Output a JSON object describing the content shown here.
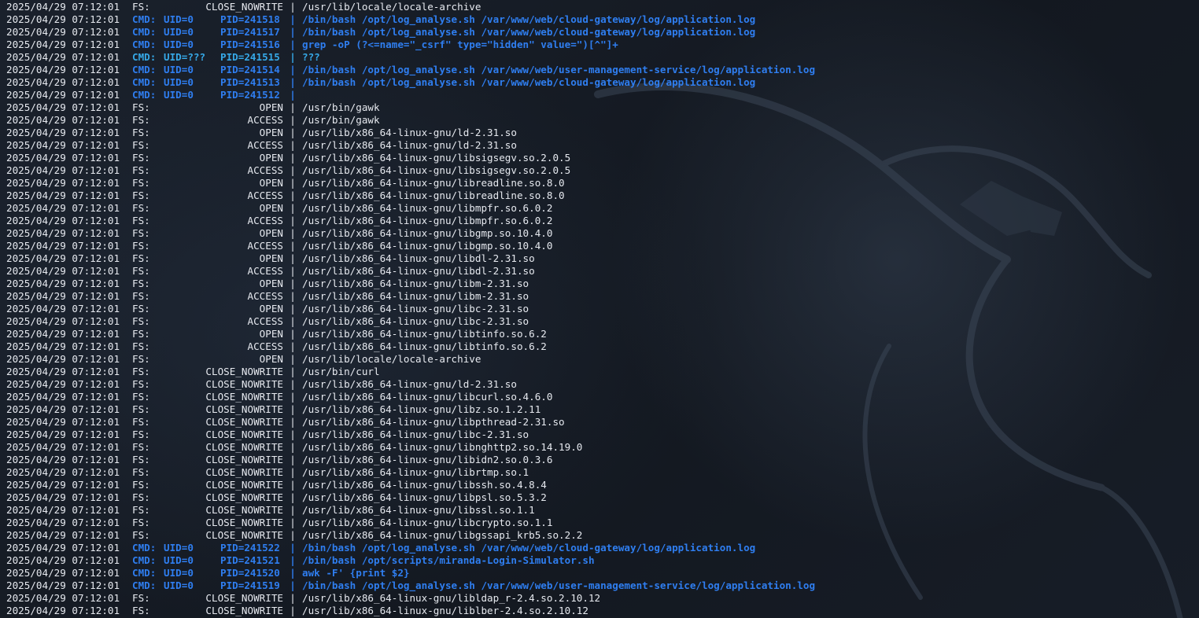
{
  "terminal": {
    "colors": {
      "background": "#151a22",
      "text": "#e6e9ef",
      "cmd_highlight": "#2f7ef0",
      "unknown_uid_highlight": "#36a9e8"
    },
    "lines": [
      {
        "ts": "2025/04/29 07:12:01",
        "type": "fs",
        "src": "FS:",
        "event": "CLOSE_NOWRITE",
        "sep": "|",
        "path": "/usr/lib/locale/locale-archive"
      },
      {
        "ts": "2025/04/29 07:12:01",
        "type": "cmd",
        "src": "CMD:",
        "uid": "UID=0",
        "pid": "PID=241518",
        "sep": "|",
        "path": "/bin/bash /opt/log_analyse.sh /var/www/web/cloud-gateway/log/application.log"
      },
      {
        "ts": "2025/04/29 07:12:01",
        "type": "cmd",
        "src": "CMD:",
        "uid": "UID=0",
        "pid": "PID=241517",
        "sep": "|",
        "path": "/bin/bash /opt/log_analyse.sh /var/www/web/cloud-gateway/log/application.log"
      },
      {
        "ts": "2025/04/29 07:12:01",
        "type": "cmd",
        "src": "CMD:",
        "uid": "UID=0",
        "pid": "PID=241516",
        "sep": "|",
        "path": "grep -oP (?<=name=\"_csrf\" type=\"hidden\" value=\")[^\"]+"
      },
      {
        "ts": "2025/04/29 07:12:01",
        "type": "cmd-unknown",
        "src": "CMD:",
        "uid": "UID=???",
        "pid": "PID=241515",
        "sep": "|",
        "path": "???"
      },
      {
        "ts": "2025/04/29 07:12:01",
        "type": "cmd",
        "src": "CMD:",
        "uid": "UID=0",
        "pid": "PID=241514",
        "sep": "|",
        "path": "/bin/bash /opt/log_analyse.sh /var/www/web/user-management-service/log/application.log"
      },
      {
        "ts": "2025/04/29 07:12:01",
        "type": "cmd",
        "src": "CMD:",
        "uid": "UID=0",
        "pid": "PID=241513",
        "sep": "|",
        "path": "/bin/bash /opt/log_analyse.sh /var/www/web/cloud-gateway/log/application.log"
      },
      {
        "ts": "2025/04/29 07:12:01",
        "type": "cmd",
        "src": "CMD:",
        "uid": "UID=0",
        "pid": "PID=241512",
        "sep": "|",
        "path": ""
      },
      {
        "ts": "2025/04/29 07:12:01",
        "type": "fs",
        "src": "FS:",
        "event": "OPEN",
        "sep": "|",
        "path": "/usr/bin/gawk"
      },
      {
        "ts": "2025/04/29 07:12:01",
        "type": "fs",
        "src": "FS:",
        "event": "ACCESS",
        "sep": "|",
        "path": "/usr/bin/gawk"
      },
      {
        "ts": "2025/04/29 07:12:01",
        "type": "fs",
        "src": "FS:",
        "event": "OPEN",
        "sep": "|",
        "path": "/usr/lib/x86_64-linux-gnu/ld-2.31.so"
      },
      {
        "ts": "2025/04/29 07:12:01",
        "type": "fs",
        "src": "FS:",
        "event": "ACCESS",
        "sep": "|",
        "path": "/usr/lib/x86_64-linux-gnu/ld-2.31.so"
      },
      {
        "ts": "2025/04/29 07:12:01",
        "type": "fs",
        "src": "FS:",
        "event": "OPEN",
        "sep": "|",
        "path": "/usr/lib/x86_64-linux-gnu/libsigsegv.so.2.0.5"
      },
      {
        "ts": "2025/04/29 07:12:01",
        "type": "fs",
        "src": "FS:",
        "event": "ACCESS",
        "sep": "|",
        "path": "/usr/lib/x86_64-linux-gnu/libsigsegv.so.2.0.5"
      },
      {
        "ts": "2025/04/29 07:12:01",
        "type": "fs",
        "src": "FS:",
        "event": "OPEN",
        "sep": "|",
        "path": "/usr/lib/x86_64-linux-gnu/libreadline.so.8.0"
      },
      {
        "ts": "2025/04/29 07:12:01",
        "type": "fs",
        "src": "FS:",
        "event": "ACCESS",
        "sep": "|",
        "path": "/usr/lib/x86_64-linux-gnu/libreadline.so.8.0"
      },
      {
        "ts": "2025/04/29 07:12:01",
        "type": "fs",
        "src": "FS:",
        "event": "OPEN",
        "sep": "|",
        "path": "/usr/lib/x86_64-linux-gnu/libmpfr.so.6.0.2"
      },
      {
        "ts": "2025/04/29 07:12:01",
        "type": "fs",
        "src": "FS:",
        "event": "ACCESS",
        "sep": "|",
        "path": "/usr/lib/x86_64-linux-gnu/libmpfr.so.6.0.2"
      },
      {
        "ts": "2025/04/29 07:12:01",
        "type": "fs",
        "src": "FS:",
        "event": "OPEN",
        "sep": "|",
        "path": "/usr/lib/x86_64-linux-gnu/libgmp.so.10.4.0"
      },
      {
        "ts": "2025/04/29 07:12:01",
        "type": "fs",
        "src": "FS:",
        "event": "ACCESS",
        "sep": "|",
        "path": "/usr/lib/x86_64-linux-gnu/libgmp.so.10.4.0"
      },
      {
        "ts": "2025/04/29 07:12:01",
        "type": "fs",
        "src": "FS:",
        "event": "OPEN",
        "sep": "|",
        "path": "/usr/lib/x86_64-linux-gnu/libdl-2.31.so"
      },
      {
        "ts": "2025/04/29 07:12:01",
        "type": "fs",
        "src": "FS:",
        "event": "ACCESS",
        "sep": "|",
        "path": "/usr/lib/x86_64-linux-gnu/libdl-2.31.so"
      },
      {
        "ts": "2025/04/29 07:12:01",
        "type": "fs",
        "src": "FS:",
        "event": "OPEN",
        "sep": "|",
        "path": "/usr/lib/x86_64-linux-gnu/libm-2.31.so"
      },
      {
        "ts": "2025/04/29 07:12:01",
        "type": "fs",
        "src": "FS:",
        "event": "ACCESS",
        "sep": "|",
        "path": "/usr/lib/x86_64-linux-gnu/libm-2.31.so"
      },
      {
        "ts": "2025/04/29 07:12:01",
        "type": "fs",
        "src": "FS:",
        "event": "OPEN",
        "sep": "|",
        "path": "/usr/lib/x86_64-linux-gnu/libc-2.31.so"
      },
      {
        "ts": "2025/04/29 07:12:01",
        "type": "fs",
        "src": "FS:",
        "event": "ACCESS",
        "sep": "|",
        "path": "/usr/lib/x86_64-linux-gnu/libc-2.31.so"
      },
      {
        "ts": "2025/04/29 07:12:01",
        "type": "fs",
        "src": "FS:",
        "event": "OPEN",
        "sep": "|",
        "path": "/usr/lib/x86_64-linux-gnu/libtinfo.so.6.2"
      },
      {
        "ts": "2025/04/29 07:12:01",
        "type": "fs",
        "src": "FS:",
        "event": "ACCESS",
        "sep": "|",
        "path": "/usr/lib/x86_64-linux-gnu/libtinfo.so.6.2"
      },
      {
        "ts": "2025/04/29 07:12:01",
        "type": "fs",
        "src": "FS:",
        "event": "OPEN",
        "sep": "|",
        "path": "/usr/lib/locale/locale-archive"
      },
      {
        "ts": "2025/04/29 07:12:01",
        "type": "fs",
        "src": "FS:",
        "event": "CLOSE_NOWRITE",
        "sep": "|",
        "path": "/usr/bin/curl"
      },
      {
        "ts": "2025/04/29 07:12:01",
        "type": "fs",
        "src": "FS:",
        "event": "CLOSE_NOWRITE",
        "sep": "|",
        "path": "/usr/lib/x86_64-linux-gnu/ld-2.31.so"
      },
      {
        "ts": "2025/04/29 07:12:01",
        "type": "fs",
        "src": "FS:",
        "event": "CLOSE_NOWRITE",
        "sep": "|",
        "path": "/usr/lib/x86_64-linux-gnu/libcurl.so.4.6.0"
      },
      {
        "ts": "2025/04/29 07:12:01",
        "type": "fs",
        "src": "FS:",
        "event": "CLOSE_NOWRITE",
        "sep": "|",
        "path": "/usr/lib/x86_64-linux-gnu/libz.so.1.2.11"
      },
      {
        "ts": "2025/04/29 07:12:01",
        "type": "fs",
        "src": "FS:",
        "event": "CLOSE_NOWRITE",
        "sep": "|",
        "path": "/usr/lib/x86_64-linux-gnu/libpthread-2.31.so"
      },
      {
        "ts": "2025/04/29 07:12:01",
        "type": "fs",
        "src": "FS:",
        "event": "CLOSE_NOWRITE",
        "sep": "|",
        "path": "/usr/lib/x86_64-linux-gnu/libc-2.31.so"
      },
      {
        "ts": "2025/04/29 07:12:01",
        "type": "fs",
        "src": "FS:",
        "event": "CLOSE_NOWRITE",
        "sep": "|",
        "path": "/usr/lib/x86_64-linux-gnu/libnghttp2.so.14.19.0"
      },
      {
        "ts": "2025/04/29 07:12:01",
        "type": "fs",
        "src": "FS:",
        "event": "CLOSE_NOWRITE",
        "sep": "|",
        "path": "/usr/lib/x86_64-linux-gnu/libidn2.so.0.3.6"
      },
      {
        "ts": "2025/04/29 07:12:01",
        "type": "fs",
        "src": "FS:",
        "event": "CLOSE_NOWRITE",
        "sep": "|",
        "path": "/usr/lib/x86_64-linux-gnu/librtmp.so.1"
      },
      {
        "ts": "2025/04/29 07:12:01",
        "type": "fs",
        "src": "FS:",
        "event": "CLOSE_NOWRITE",
        "sep": "|",
        "path": "/usr/lib/x86_64-linux-gnu/libssh.so.4.8.4"
      },
      {
        "ts": "2025/04/29 07:12:01",
        "type": "fs",
        "src": "FS:",
        "event": "CLOSE_NOWRITE",
        "sep": "|",
        "path": "/usr/lib/x86_64-linux-gnu/libpsl.so.5.3.2"
      },
      {
        "ts": "2025/04/29 07:12:01",
        "type": "fs",
        "src": "FS:",
        "event": "CLOSE_NOWRITE",
        "sep": "|",
        "path": "/usr/lib/x86_64-linux-gnu/libssl.so.1.1"
      },
      {
        "ts": "2025/04/29 07:12:01",
        "type": "fs",
        "src": "FS:",
        "event": "CLOSE_NOWRITE",
        "sep": "|",
        "path": "/usr/lib/x86_64-linux-gnu/libcrypto.so.1.1"
      },
      {
        "ts": "2025/04/29 07:12:01",
        "type": "fs",
        "src": "FS:",
        "event": "CLOSE_NOWRITE",
        "sep": "|",
        "path": "/usr/lib/x86_64-linux-gnu/libgssapi_krb5.so.2.2"
      },
      {
        "ts": "2025/04/29 07:12:01",
        "type": "cmd",
        "src": "CMD:",
        "uid": "UID=0",
        "pid": "PID=241522",
        "sep": "|",
        "path": "/bin/bash /opt/log_analyse.sh /var/www/web/cloud-gateway/log/application.log"
      },
      {
        "ts": "2025/04/29 07:12:01",
        "type": "cmd",
        "src": "CMD:",
        "uid": "UID=0",
        "pid": "PID=241521",
        "sep": "|",
        "path": "/bin/bash /opt/scripts/miranda-Login-Simulator.sh"
      },
      {
        "ts": "2025/04/29 07:12:01",
        "type": "cmd",
        "src": "CMD:",
        "uid": "UID=0",
        "pid": "PID=241520",
        "sep": "|",
        "path": "awk -F' {print $2}"
      },
      {
        "ts": "2025/04/29 07:12:01",
        "type": "cmd",
        "src": "CMD:",
        "uid": "UID=0",
        "pid": "PID=241519",
        "sep": "|",
        "path": "/bin/bash /opt/log_analyse.sh /var/www/web/user-management-service/log/application.log"
      },
      {
        "ts": "2025/04/29 07:12:01",
        "type": "fs",
        "src": "FS:",
        "event": "CLOSE_NOWRITE",
        "sep": "|",
        "path": "/usr/lib/x86_64-linux-gnu/libldap_r-2.4.so.2.10.12"
      },
      {
        "ts": "2025/04/29 07:12:01",
        "type": "fs",
        "src": "FS:",
        "event": "CLOSE_NOWRITE",
        "sep": "|",
        "path": "/usr/lib/x86_64-linux-gnu/liblber-2.4.so.2.10.12"
      }
    ]
  }
}
